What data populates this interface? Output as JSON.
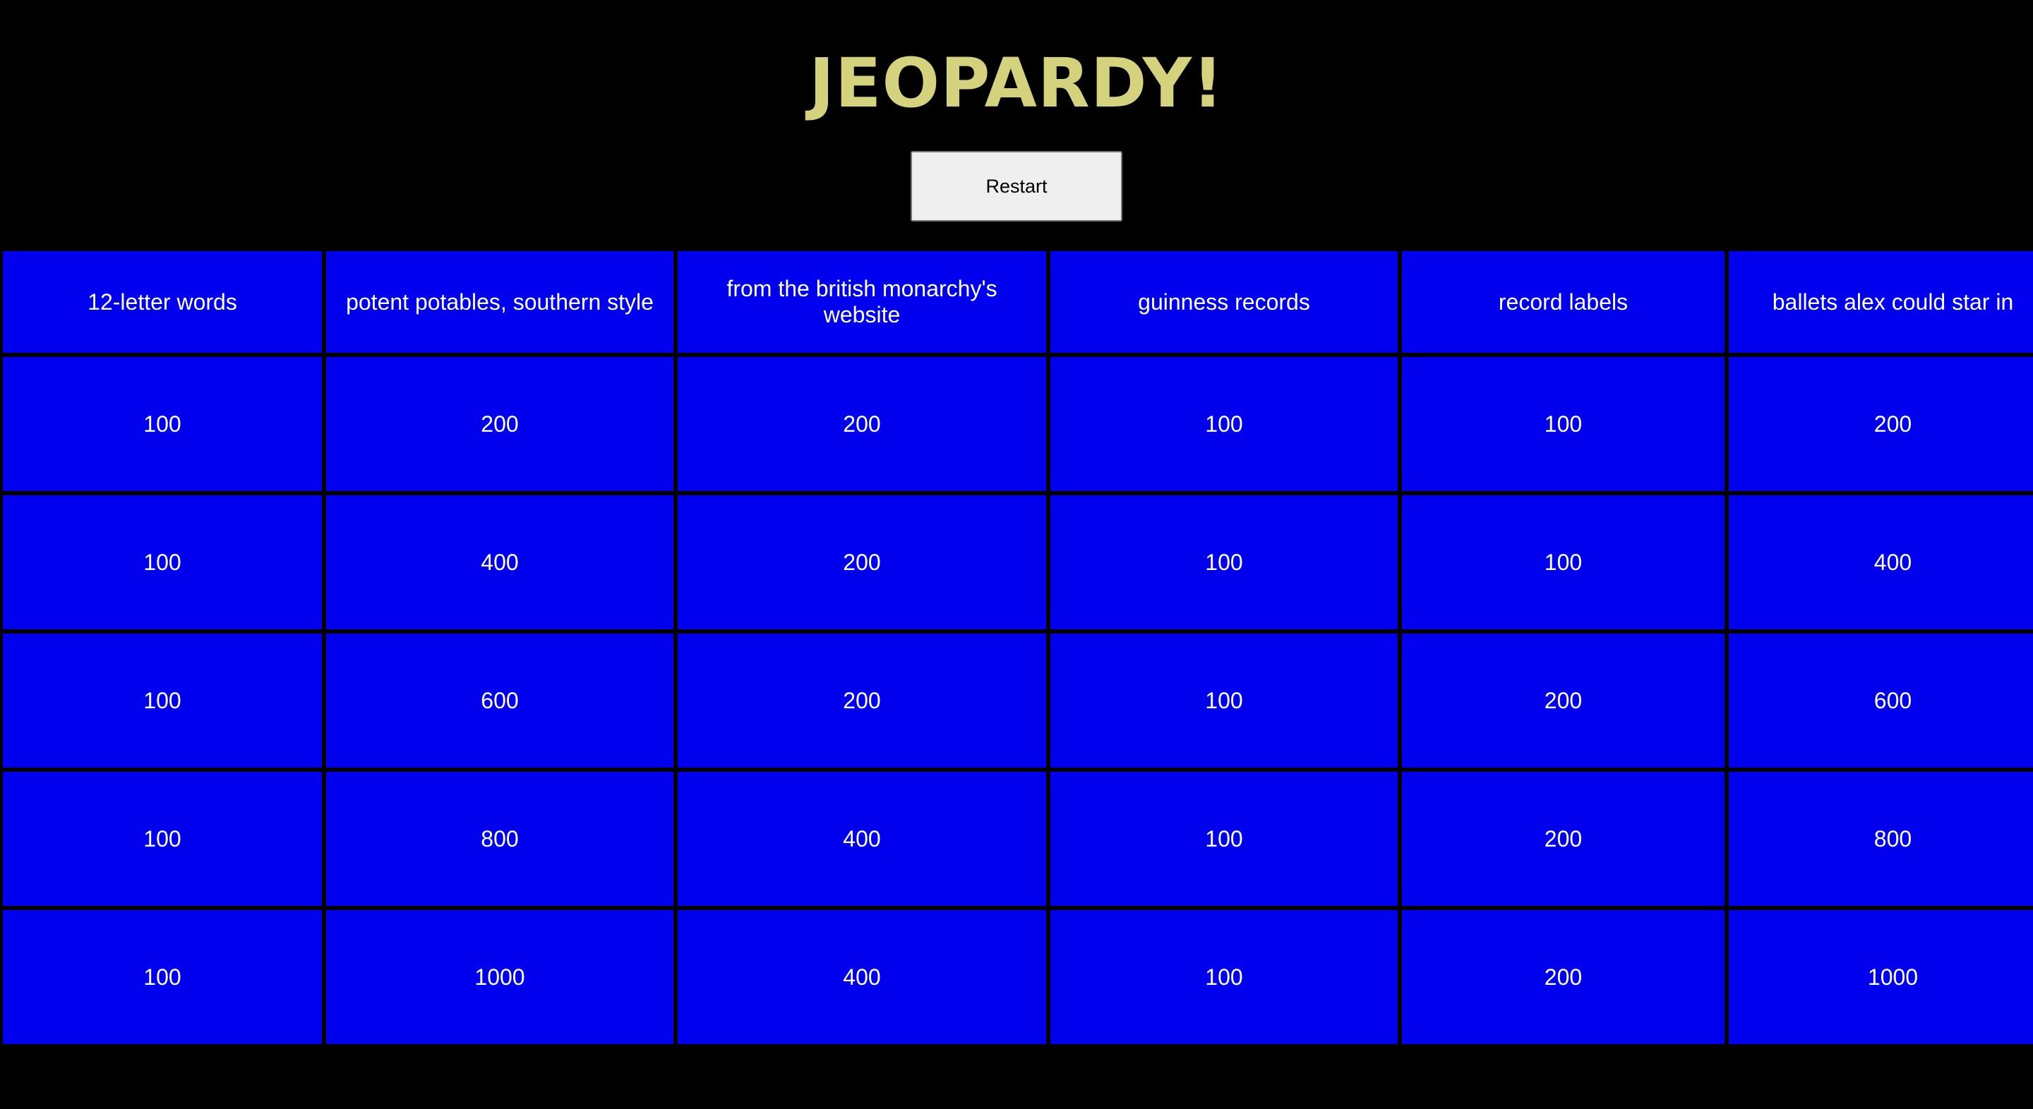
{
  "title": "JEOPARDY!",
  "restart_label": "Restart",
  "colors": {
    "background": "#000000",
    "title": "#d4d27c",
    "cell": "#0000ee",
    "cell_text": "#ffffff"
  },
  "categories": [
    "12-letter words",
    "potent potables, southern style",
    "from the british monarchy's website",
    "guinness records",
    "record labels",
    "ballets alex could star in"
  ],
  "rows": [
    [
      "100",
      "200",
      "200",
      "100",
      "100",
      "200"
    ],
    [
      "100",
      "400",
      "200",
      "100",
      "100",
      "400"
    ],
    [
      "100",
      "600",
      "200",
      "100",
      "200",
      "600"
    ],
    [
      "100",
      "800",
      "400",
      "100",
      "200",
      "800"
    ],
    [
      "100",
      "1000",
      "400",
      "100",
      "200",
      "1000"
    ]
  ]
}
